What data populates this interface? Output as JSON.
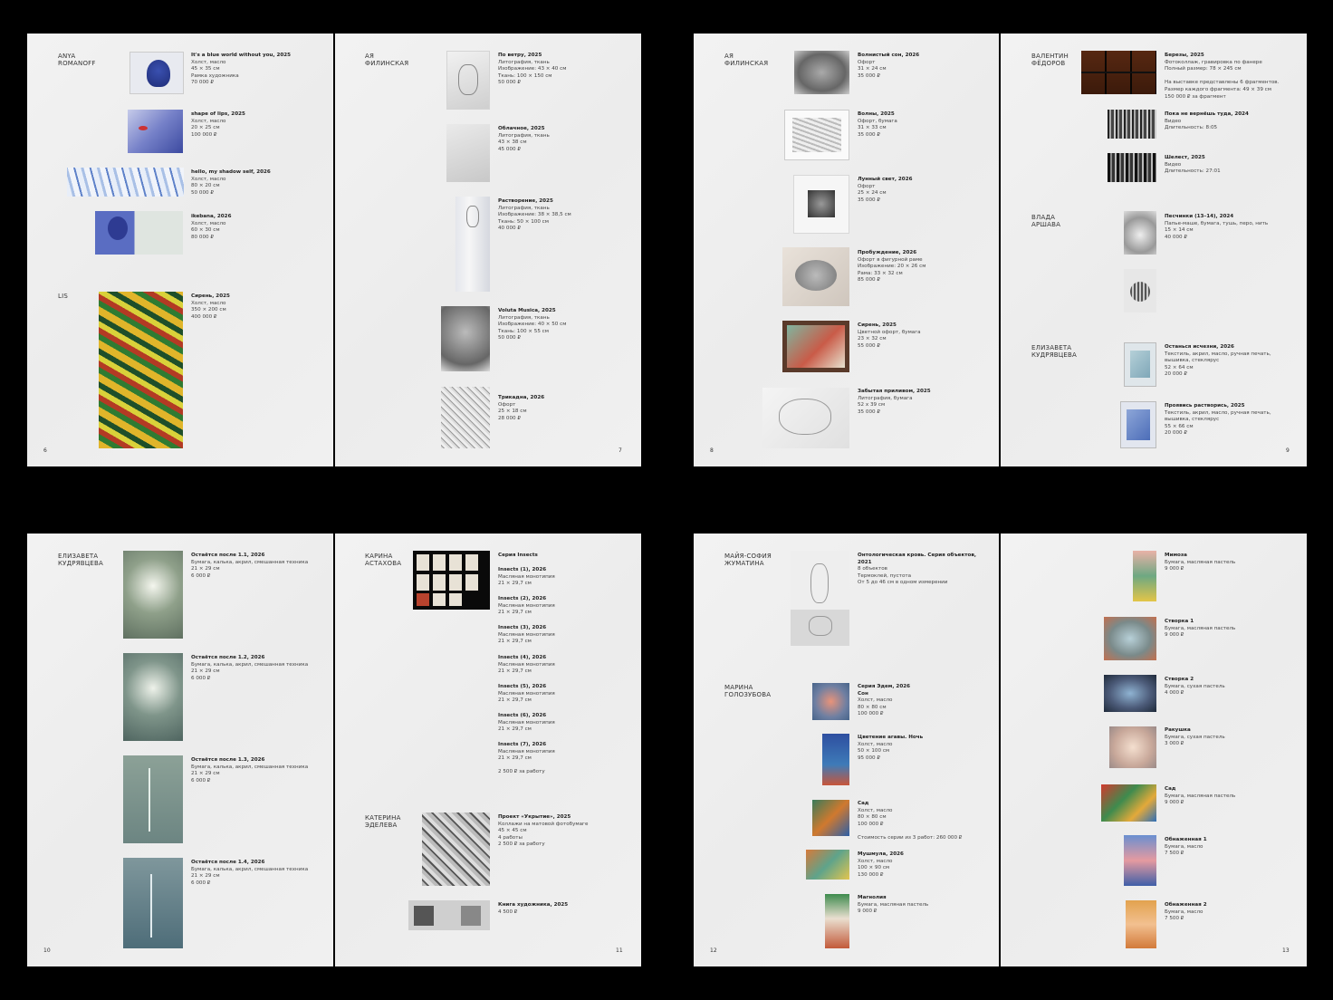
{
  "spreads": [
    {
      "left_page": 6,
      "right_page": 7
    }
  ],
  "pages": {
    "p6": {
      "number": "6",
      "artists": [
        {
          "name": "ANYA\nROMANOFF"
        },
        {
          "name": "LIS"
        }
      ],
      "works": [
        {
          "title": "It's a blue world without you, 2025",
          "lines": [
            "Холст, масло",
            "45 × 35 см",
            "Рамка художника",
            "70 000 ₽"
          ]
        },
        {
          "title": "shape of lips, 2025",
          "lines": [
            "Холст, масло",
            "20 × 25 см",
            "100 000 ₽"
          ]
        },
        {
          "title": "hello, my shadow self, 2026",
          "lines": [
            "Холст, масло",
            "80 × 20 см",
            "50 000 ₽"
          ]
        },
        {
          "title": "ikebana, 2026",
          "lines": [
            "Холст, масло",
            "60 × 30 см",
            "80 000 ₽"
          ]
        },
        {
          "title": "Сирень, 2025",
          "lines": [
            "Холст, масло",
            "350 × 200 см",
            "400 000 ₽"
          ]
        }
      ]
    },
    "p7": {
      "number": "7",
      "artists": [
        {
          "name": "АЯ\nФИЛИНСКАЯ"
        }
      ],
      "works": [
        {
          "title": "По ветру, 2025",
          "lines": [
            "Литография, ткань",
            "Изображение: 43 × 40 см",
            "Ткань: 100 × 150 см",
            "50 000 ₽"
          ]
        },
        {
          "title": "Облачное, 2025",
          "lines": [
            "Литография, ткань",
            "43 × 38 см",
            "45 000 ₽"
          ]
        },
        {
          "title": "Растворение, 2025",
          "lines": [
            "Литография, ткань",
            "Изображение: 38 × 38,5 см",
            "Ткань: 50 × 100 см",
            "40 000 ₽"
          ]
        },
        {
          "title": "Voluta Musica, 2025",
          "lines": [
            "Литография, ткань",
            "Изображение: 40 × 50 см",
            "Ткань: 100 × 55 см",
            "50 000 ₽"
          ]
        },
        {
          "title": "Трикадна, 2026",
          "lines": [
            "Офорт",
            "25 × 18 см",
            "28 000 ₽"
          ]
        }
      ]
    },
    "p8": {
      "number": "8",
      "artists": [
        {
          "name": "АЯ\nФИЛИНСКАЯ"
        }
      ],
      "works": [
        {
          "title": "Волнистый сон, 2026",
          "lines": [
            "Офорт",
            "31 × 24 см",
            "35 000 ₽"
          ]
        },
        {
          "title": "Волны, 2025",
          "lines": [
            "Офорт, бумага",
            "31 × 33 см",
            "35 000 ₽"
          ]
        },
        {
          "title": "Лунный свет, 2026",
          "lines": [
            "Офорт",
            "25 × 24 см",
            "35 000 ₽"
          ]
        },
        {
          "title": "Пробуждение, 2026",
          "lines": [
            "Офорт в фигурной раме",
            "Изображение: 20 × 26 см",
            "Рама: 33 × 32 см",
            "85 000 ₽"
          ]
        },
        {
          "title": "Сирень, 2025",
          "lines": [
            "Цветной офорт, бумага",
            "23 × 32 см",
            "55 000 ₽"
          ]
        },
        {
          "title": "Забытая приливом, 2025",
          "lines": [
            "Литография, бумага",
            "52 х 39 см",
            "35 000 ₽"
          ]
        }
      ]
    },
    "p9": {
      "number": "9",
      "artists": [
        {
          "name": "ВАЛЕНТИН\nФЁДОРОВ"
        },
        {
          "name": "ВЛАДА\nАРШАВА"
        },
        {
          "name": "ЕЛИЗАВЕТА\nКУДРЯВЦЕВА"
        }
      ],
      "works": [
        {
          "title": "Березы, 2025",
          "lines": [
            "Фотоколлаж, гравировка по фанере",
            "Полный размер: 78 × 245 см",
            "",
            "На выставке представлены 6 фрагментов.",
            "Размер каждого фрагмента: 49 × 39 см",
            "150 000 ₽ за фрагмент"
          ]
        },
        {
          "title": "Пока не вернёшь туда, 2024",
          "lines": [
            "Видео",
            "Длительность: 8:05"
          ]
        },
        {
          "title": "Шелест, 2025",
          "lines": [
            "Видео",
            "Длительность: 27:01"
          ]
        },
        {
          "title": "Песчинки (13–14), 2024",
          "lines": [
            "Папье-маше, бумага, тушь, перо, нить",
            "15 × 14 см",
            "40 000 ₽"
          ]
        },
        {
          "title": "Останься исчезни, 2026",
          "lines": [
            "Текстиль, акрил, масло, ручная печать,",
            "вышивка, стеклярус",
            "52 × 64 см",
            "20 000 ₽"
          ]
        },
        {
          "title": "Проявись растворись, 2025",
          "lines": [
            "Текстиль, акрил, масло, ручная печать,",
            "вышивка, стеклярус",
            "55 × 66 см",
            "20 000 ₽"
          ]
        }
      ]
    },
    "p10": {
      "number": "10",
      "artists": [
        {
          "name": "ЕЛИЗАВЕТА\nКУДРЯВЦЕВА"
        }
      ],
      "works": [
        {
          "title": "Остаётся после 1.1, 2026",
          "lines": [
            "Бумага, калька, акрил, смешанная техника",
            "21 × 29 см",
            "6 000 ₽"
          ]
        },
        {
          "title": "Остаётся после 1.2, 2026",
          "lines": [
            "Бумага, калька, акрил, смешанная техника",
            "21 × 29 см",
            "6 000 ₽"
          ]
        },
        {
          "title": "Остаётся после 1.3, 2026",
          "lines": [
            "Бумага, калька, акрил, смешанная техника",
            "21 × 29 см",
            "6 000 ₽"
          ]
        },
        {
          "title": "Остаётся после 1.4, 2026",
          "lines": [
            "Бумага, калька, акрил, смешанная техника",
            "21 × 29 см",
            "6 000 ₽"
          ]
        }
      ]
    },
    "p11": {
      "number": "11",
      "artists": [
        {
          "name": "КАРИНА\nАСТАХОВА"
        },
        {
          "name": "КАТЕРИНА\nЭДЕЛЕВА"
        }
      ],
      "works": [
        {
          "title": "Серия Insects",
          "lines": []
        },
        {
          "title": "Insects (1), 2026",
          "lines": [
            "Масляная монотипия",
            "21 × 29,7 см"
          ]
        },
        {
          "title": "Insects (2), 2026",
          "lines": [
            "Масляная монотипия",
            "21 × 29,7 см"
          ]
        },
        {
          "title": "Insects (3), 2026",
          "lines": [
            "Масляная монотипия",
            "21 × 29,7 см"
          ]
        },
        {
          "title": "Insects (4), 2026",
          "lines": [
            "Масляная монотипия",
            "21 × 29,7 см"
          ]
        },
        {
          "title": "Insects (5), 2026",
          "lines": [
            "Масляная монотипия",
            "21 × 29,7 см"
          ]
        },
        {
          "title": "Insects (6), 2026",
          "lines": [
            "Масляная монотипия",
            "21 × 29,7 см"
          ]
        },
        {
          "title": "Insects (7), 2026",
          "lines": [
            "Масляная монотипия",
            "21 × 29,7 см",
            "",
            "2 500 ₽ за работу"
          ]
        },
        {
          "title": "Проект «Укрытие», 2025",
          "lines": [
            "Коллажи на матовой фотобумаге",
            "45 × 45 см",
            "4 работы",
            "2 500 ₽ за работу"
          ]
        },
        {
          "title": "Книга художника, 2025",
          "lines": [
            "4 500 ₽"
          ]
        }
      ]
    },
    "p12": {
      "number": "12",
      "artists": [
        {
          "name": "МАЙЯ-СОФИЯ\nЖУМАТИНА"
        },
        {
          "name": "МАРИНА\nГОЛОЗУБОВА"
        }
      ],
      "works": [
        {
          "title": "Онтологическая кровь. Серия объектов,",
          "lines": [
            "2021"
          ],
          "title2": true,
          "plain": [
            "8 объектов",
            "Термоклей, пустота",
            "От 5 до 46 см в одном измерении"
          ]
        },
        {
          "title": "Серия Эдем, 2026",
          "lines": [
            "Сон"
          ],
          "plain": [
            "Холст, масло",
            "80 × 80 см",
            "100 000 ₽"
          ]
        },
        {
          "title": "Цветение агавы. Ночь",
          "lines": [
            "Холст, масло",
            "50 × 100 см",
            "95 000 ₽"
          ]
        },
        {
          "title": "Сад",
          "lines": [
            "Холст, масло",
            "80 × 80 см",
            "100 000 ₽",
            "",
            "Стоимость серии из 3 работ: 260 000 ₽"
          ]
        },
        {
          "title": "Мушмула, 2026",
          "lines": [
            "Холст, масло",
            "100 × 90 см",
            "130 000 ₽"
          ]
        },
        {
          "title": "Магнолия",
          "lines": [
            "Бумага, масляная пастель",
            "9 000 ₽"
          ]
        }
      ]
    },
    "p13": {
      "number": "13",
      "artists": [],
      "works": [
        {
          "title": "Мимоза",
          "lines": [
            "Бумага, масляная пастель",
            "9 000 ₽"
          ]
        },
        {
          "title": "Створка 1",
          "lines": [
            "Бумага, масляная пастель",
            "9 000 ₽"
          ]
        },
        {
          "title": "Створка 2",
          "lines": [
            "Бумага, сухая пастель",
            "4 000 ₽"
          ]
        },
        {
          "title": "Ракушка",
          "lines": [
            "Бумага, сухая пастель",
            "3 000 ₽"
          ]
        },
        {
          "title": "Сад",
          "lines": [
            "Бумага, масляная пастель",
            "9 000 ₽"
          ]
        },
        {
          "title": "Обнаженная 1",
          "lines": [
            "Бумага, масло",
            "7 500 ₽"
          ]
        },
        {
          "title": "Обнаженная 2",
          "lines": [
            "Бумага, масло",
            "7 500 ₽"
          ]
        }
      ]
    }
  }
}
